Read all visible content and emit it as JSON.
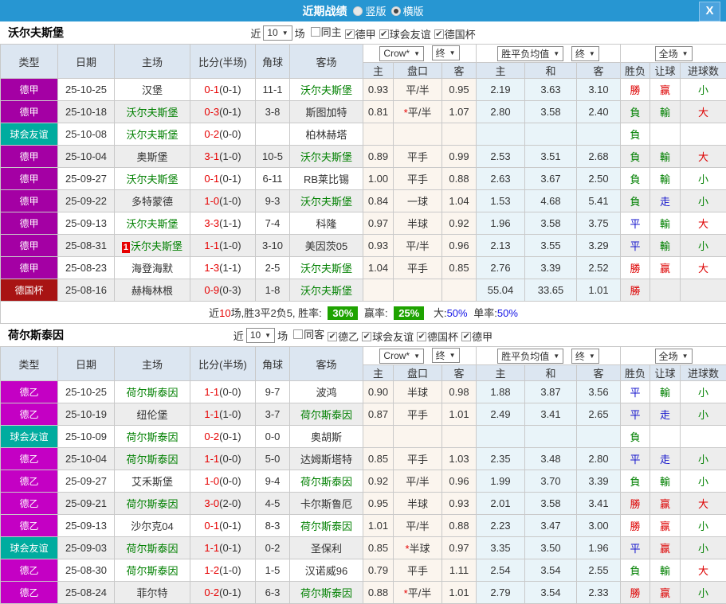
{
  "icons": {
    "arrow_down": "▼",
    "check": "✔",
    "close": "X"
  },
  "titlebar": {
    "title": "近期战绩",
    "radio_vertical": {
      "label": "竖版",
      "checked": false
    },
    "radio_horizontal": {
      "label": "横版",
      "checked": true
    }
  },
  "table_header": {
    "cols": [
      "类型",
      "日期",
      "主场",
      "比分(半场)",
      "角球",
      "客场"
    ],
    "selects": [
      "Crow*",
      "终",
      "胜平负均值",
      "终",
      "全场"
    ],
    "sub": [
      "主",
      "盘口",
      "客",
      "主",
      "和",
      "客",
      "胜负",
      "让球",
      "进球数"
    ]
  },
  "league_colors": {
    "德甲": "#a400a4",
    "德乙": "#c400c4",
    "球会友谊": "#00ac9f",
    "德国杯": "#a81414"
  },
  "result_colors": {
    "勝": "#dd0000",
    "平": "#1515cc",
    "負": "#008000",
    "赢": "#dd0000",
    "走": "#1515cc",
    "輸": "#008000",
    "大": "#dd0000",
    "小": "#008000"
  },
  "sections": [
    {
      "team": "沃尔夫斯堡",
      "filter": {
        "near_label": "近",
        "count": "10",
        "games_label": "场",
        "checkboxes": [
          {
            "label": "同主",
            "checked": false
          },
          {
            "label": "德甲",
            "checked": true
          },
          {
            "label": "球会友谊",
            "checked": true
          },
          {
            "label": "德国杯",
            "checked": true
          }
        ]
      },
      "rows": [
        {
          "league": "德甲",
          "date": "25-10-25",
          "home": "汉堡",
          "home_green": false,
          "home_badge": "",
          "score": "0-1",
          "half": "(0-1)",
          "corners": "11-1",
          "away": "沃尔夫斯堡",
          "away_green": true,
          "odds_home": "0.93",
          "handicap": "平/半",
          "handicap_star": false,
          "odds_away": "0.95",
          "avg_home": "2.19",
          "avg_draw": "3.63",
          "avg_away": "3.10",
          "result": "勝",
          "handicap_result": "赢",
          "goals_result": "小"
        },
        {
          "league": "德甲",
          "date": "25-10-18",
          "home": "沃尔夫斯堡",
          "home_green": true,
          "home_badge": "",
          "score": "0-3",
          "half": "(0-1)",
          "corners": "3-8",
          "away": "斯图加特",
          "away_green": false,
          "odds_home": "0.81",
          "handicap": "平/半",
          "handicap_star": true,
          "odds_away": "1.07",
          "avg_home": "2.80",
          "avg_draw": "3.58",
          "avg_away": "2.40",
          "result": "負",
          "handicap_result": "輸",
          "goals_result": "大"
        },
        {
          "league": "球会友谊",
          "date": "25-10-08",
          "home": "沃尔夫斯堡",
          "home_green": true,
          "home_badge": "",
          "score": "0-2",
          "half": "(0-0)",
          "corners": "",
          "away": "柏林赫塔",
          "away_green": false,
          "odds_home": "",
          "handicap": "",
          "handicap_star": false,
          "odds_away": "",
          "avg_home": "",
          "avg_draw": "",
          "avg_away": "",
          "result": "負",
          "handicap_result": "",
          "goals_result": ""
        },
        {
          "league": "德甲",
          "date": "25-10-04",
          "home": "奥斯堡",
          "home_green": false,
          "home_badge": "",
          "score": "3-1",
          "half": "(1-0)",
          "corners": "10-5",
          "away": "沃尔夫斯堡",
          "away_green": true,
          "odds_home": "0.89",
          "handicap": "平手",
          "handicap_star": false,
          "odds_away": "0.99",
          "avg_home": "2.53",
          "avg_draw": "3.51",
          "avg_away": "2.68",
          "result": "負",
          "handicap_result": "輸",
          "goals_result": "大"
        },
        {
          "league": "德甲",
          "date": "25-09-27",
          "home": "沃尔夫斯堡",
          "home_green": true,
          "home_badge": "",
          "score": "0-1",
          "half": "(0-1)",
          "corners": "6-11",
          "away": "RB莱比锡",
          "away_green": false,
          "odds_home": "1.00",
          "handicap": "平手",
          "handicap_star": false,
          "odds_away": "0.88",
          "avg_home": "2.63",
          "avg_draw": "3.67",
          "avg_away": "2.50",
          "result": "負",
          "handicap_result": "輸",
          "goals_result": "小"
        },
        {
          "league": "德甲",
          "date": "25-09-22",
          "home": "多特蒙德",
          "home_green": false,
          "home_badge": "",
          "score": "1-0",
          "half": "(1-0)",
          "corners": "9-3",
          "away": "沃尔夫斯堡",
          "away_green": true,
          "odds_home": "0.84",
          "handicap": "一球",
          "handicap_star": false,
          "odds_away": "1.04",
          "avg_home": "1.53",
          "avg_draw": "4.68",
          "avg_away": "5.41",
          "result": "負",
          "handicap_result": "走",
          "goals_result": "小"
        },
        {
          "league": "德甲",
          "date": "25-09-13",
          "home": "沃尔夫斯堡",
          "home_green": true,
          "home_badge": "",
          "score": "3-3",
          "half": "(1-1)",
          "corners": "7-4",
          "away": "科隆",
          "away_green": false,
          "odds_home": "0.97",
          "handicap": "半球",
          "handicap_star": false,
          "odds_away": "0.92",
          "avg_home": "1.96",
          "avg_draw": "3.58",
          "avg_away": "3.75",
          "result": "平",
          "handicap_result": "輸",
          "goals_result": "大"
        },
        {
          "league": "德甲",
          "date": "25-08-31",
          "home": "沃尔夫斯堡",
          "home_green": true,
          "home_badge": "1",
          "score": "1-1",
          "half": "(1-0)",
          "corners": "3-10",
          "away": "美因茨05",
          "away_green": false,
          "odds_home": "0.93",
          "handicap": "平/半",
          "handicap_star": false,
          "odds_away": "0.96",
          "avg_home": "2.13",
          "avg_draw": "3.55",
          "avg_away": "3.29",
          "result": "平",
          "handicap_result": "輸",
          "goals_result": "小"
        },
        {
          "league": "德甲",
          "date": "25-08-23",
          "home": "海登海默",
          "home_green": false,
          "home_badge": "",
          "score": "1-3",
          "half": "(1-1)",
          "corners": "2-5",
          "away": "沃尔夫斯堡",
          "away_green": true,
          "odds_home": "1.04",
          "handicap": "平手",
          "handicap_star": false,
          "odds_away": "0.85",
          "avg_home": "2.76",
          "avg_draw": "3.39",
          "avg_away": "2.52",
          "result": "勝",
          "handicap_result": "赢",
          "goals_result": "大"
        },
        {
          "league": "德国杯",
          "date": "25-08-16",
          "home": "赫梅林根",
          "home_green": false,
          "home_badge": "",
          "score": "0-9",
          "half": "(0-3)",
          "corners": "1-8",
          "away": "沃尔夫斯堡",
          "away_green": true,
          "odds_home": "",
          "handicap": "",
          "handicap_star": false,
          "odds_away": "",
          "avg_home": "55.04",
          "avg_draw": "33.65",
          "avg_away": "1.01",
          "result": "勝",
          "handicap_result": "",
          "goals_result": ""
        }
      ],
      "summary": {
        "prefix": "近",
        "count": "10",
        "text": "场,胜3平2负5, 胜率:",
        "win_rate": "30%",
        "mid": "赢率:",
        "cover_rate": "25%",
        "big_label": "大:",
        "big_rate": "50%",
        "single_label": "单率:",
        "single_rate": "50%"
      }
    },
    {
      "team": "荷尔斯泰因",
      "filter": {
        "near_label": "近",
        "count": "10",
        "games_label": "场",
        "checkboxes": [
          {
            "label": "同客",
            "checked": false
          },
          {
            "label": "德乙",
            "checked": true
          },
          {
            "label": "球会友谊",
            "checked": true
          },
          {
            "label": "德国杯",
            "checked": true
          },
          {
            "label": "德甲",
            "checked": true
          }
        ]
      },
      "rows": [
        {
          "league": "德乙",
          "date": "25-10-25",
          "home": "荷尔斯泰因",
          "home_green": true,
          "home_badge": "",
          "score": "1-1",
          "half": "(0-0)",
          "corners": "9-7",
          "away": "波鸿",
          "away_green": false,
          "odds_home": "0.90",
          "handicap": "半球",
          "handicap_star": false,
          "odds_away": "0.98",
          "avg_home": "1.88",
          "avg_draw": "3.87",
          "avg_away": "3.56",
          "result": "平",
          "handicap_result": "輸",
          "goals_result": "小"
        },
        {
          "league": "德乙",
          "date": "25-10-19",
          "home": "纽伦堡",
          "home_green": false,
          "home_badge": "",
          "score": "1-1",
          "half": "(1-0)",
          "corners": "3-7",
          "away": "荷尔斯泰因",
          "away_green": true,
          "odds_home": "0.87",
          "handicap": "平手",
          "handicap_star": false,
          "odds_away": "1.01",
          "avg_home": "2.49",
          "avg_draw": "3.41",
          "avg_away": "2.65",
          "result": "平",
          "handicap_result": "走",
          "goals_result": "小"
        },
        {
          "league": "球会友谊",
          "date": "25-10-09",
          "home": "荷尔斯泰因",
          "home_green": true,
          "home_badge": "",
          "score": "0-2",
          "half": "(0-1)",
          "corners": "0-0",
          "away": "奥胡斯",
          "away_green": false,
          "odds_home": "",
          "handicap": "",
          "handicap_star": false,
          "odds_away": "",
          "avg_home": "",
          "avg_draw": "",
          "avg_away": "",
          "result": "負",
          "handicap_result": "",
          "goals_result": ""
        },
        {
          "league": "德乙",
          "date": "25-10-04",
          "home": "荷尔斯泰因",
          "home_green": true,
          "home_badge": "",
          "score": "1-1",
          "half": "(0-0)",
          "corners": "5-0",
          "away": "达姆斯塔特",
          "away_green": false,
          "odds_home": "0.85",
          "handicap": "平手",
          "handicap_star": false,
          "odds_away": "1.03",
          "avg_home": "2.35",
          "avg_draw": "3.48",
          "avg_away": "2.80",
          "result": "平",
          "handicap_result": "走",
          "goals_result": "小"
        },
        {
          "league": "德乙",
          "date": "25-09-27",
          "home": "艾禾斯堡",
          "home_green": false,
          "home_badge": "",
          "score": "1-0",
          "half": "(0-0)",
          "corners": "9-4",
          "away": "荷尔斯泰因",
          "away_green": true,
          "odds_home": "0.92",
          "handicap": "平/半",
          "handicap_star": false,
          "odds_away": "0.96",
          "avg_home": "1.99",
          "avg_draw": "3.70",
          "avg_away": "3.39",
          "result": "負",
          "handicap_result": "輸",
          "goals_result": "小"
        },
        {
          "league": "德乙",
          "date": "25-09-21",
          "home": "荷尔斯泰因",
          "home_green": true,
          "home_badge": "",
          "score": "3-0",
          "half": "(2-0)",
          "corners": "4-5",
          "away": "卡尔斯鲁厄",
          "away_green": false,
          "odds_home": "0.95",
          "handicap": "半球",
          "handicap_star": false,
          "odds_away": "0.93",
          "avg_home": "2.01",
          "avg_draw": "3.58",
          "avg_away": "3.41",
          "result": "勝",
          "handicap_result": "赢",
          "goals_result": "大"
        },
        {
          "league": "德乙",
          "date": "25-09-13",
          "home": "沙尔克04",
          "home_green": false,
          "home_badge": "",
          "score": "0-1",
          "half": "(0-1)",
          "corners": "8-3",
          "away": "荷尔斯泰因",
          "away_green": true,
          "odds_home": "1.01",
          "handicap": "平/半",
          "handicap_star": false,
          "odds_away": "0.88",
          "avg_home": "2.23",
          "avg_draw": "3.47",
          "avg_away": "3.00",
          "result": "勝",
          "handicap_result": "赢",
          "goals_result": "小"
        },
        {
          "league": "球会友谊",
          "date": "25-09-03",
          "home": "荷尔斯泰因",
          "home_green": true,
          "home_badge": "",
          "score": "1-1",
          "half": "(0-1)",
          "corners": "0-2",
          "away": "圣保利",
          "away_green": false,
          "odds_home": "0.85",
          "handicap": "半球",
          "handicap_star": true,
          "odds_away": "0.97",
          "avg_home": "3.35",
          "avg_draw": "3.50",
          "avg_away": "1.96",
          "result": "平",
          "handicap_result": "赢",
          "goals_result": "小"
        },
        {
          "league": "德乙",
          "date": "25-08-30",
          "home": "荷尔斯泰因",
          "home_green": true,
          "home_badge": "",
          "score": "1-2",
          "half": "(1-0)",
          "corners": "1-5",
          "away": "汉诺威96",
          "away_green": false,
          "odds_home": "0.79",
          "handicap": "平手",
          "handicap_star": false,
          "odds_away": "1.11",
          "avg_home": "2.54",
          "avg_draw": "3.54",
          "avg_away": "2.55",
          "result": "負",
          "handicap_result": "輸",
          "goals_result": "大"
        },
        {
          "league": "德乙",
          "date": "25-08-24",
          "home": "菲尔特",
          "home_green": false,
          "home_badge": "",
          "score": "0-2",
          "half": "(0-1)",
          "corners": "6-3",
          "away": "荷尔斯泰因",
          "away_green": true,
          "odds_home": "0.88",
          "handicap": "平/半",
          "handicap_star": true,
          "odds_away": "1.01",
          "avg_home": "2.79",
          "avg_draw": "3.54",
          "avg_away": "2.33",
          "result": "勝",
          "handicap_result": "赢",
          "goals_result": "小"
        }
      ],
      "summary": null
    }
  ]
}
